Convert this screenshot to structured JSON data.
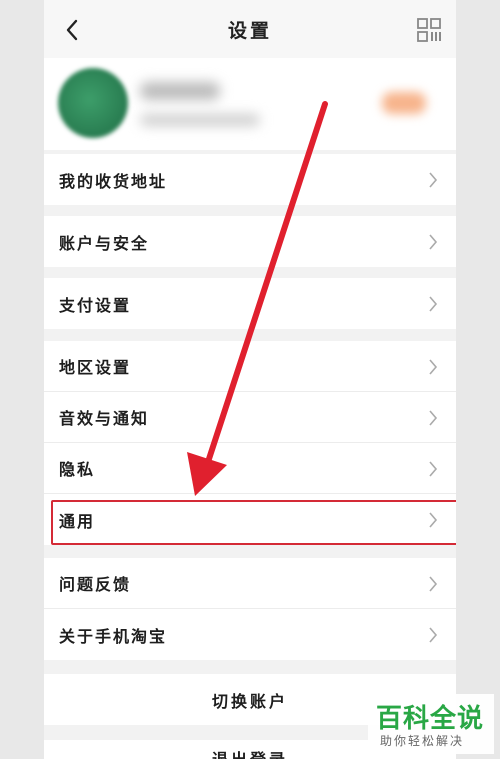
{
  "header": {
    "title": "设置",
    "back_icon": "chevron-left-icon",
    "qr_icon": "qr-code-icon"
  },
  "profile": {
    "avatar_icon": "avatar"
  },
  "groups": [
    {
      "items": [
        {
          "label": "我的收货地址"
        }
      ]
    },
    {
      "items": [
        {
          "label": "账户与安全"
        }
      ]
    },
    {
      "items": [
        {
          "label": "支付设置"
        }
      ]
    },
    {
      "items": [
        {
          "label": "地区设置"
        },
        {
          "label": "音效与通知"
        },
        {
          "label": "隐私"
        },
        {
          "label": "通用"
        }
      ]
    },
    {
      "items": [
        {
          "label": "问题反馈"
        },
        {
          "label": "关于手机淘宝"
        }
      ]
    }
  ],
  "switch_account": {
    "label": "切换账户"
  },
  "logout": {
    "label": "退出登录"
  },
  "annotation": {
    "highlight_color": "#d42a36",
    "arrow_color": "#e0202e"
  },
  "watermark": {
    "main": "百科全说",
    "sub": "助你轻松解决",
    "color": "#29a745"
  }
}
